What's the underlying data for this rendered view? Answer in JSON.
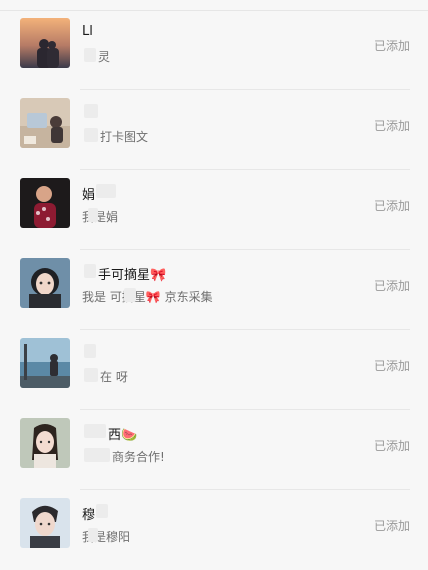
{
  "contacts": [
    {
      "name": "Ll",
      "note": "灵",
      "status": "已添加"
    },
    {
      "name": "",
      "note": "打卡图文",
      "status": "已添加"
    },
    {
      "name": "娟",
      "note": "我是娟",
      "status": "已添加"
    },
    {
      "name": "手可摘星🎀",
      "note": "我是 可摘星🎀 京东采集",
      "status": "已添加"
    },
    {
      "name": "",
      "note": "在 呀",
      "status": "已添加"
    },
    {
      "name": "西🍉",
      "note": "商务合作!",
      "status": "已添加"
    },
    {
      "name": "穆",
      "note": "我是穆阳",
      "status": "已添加"
    }
  ]
}
